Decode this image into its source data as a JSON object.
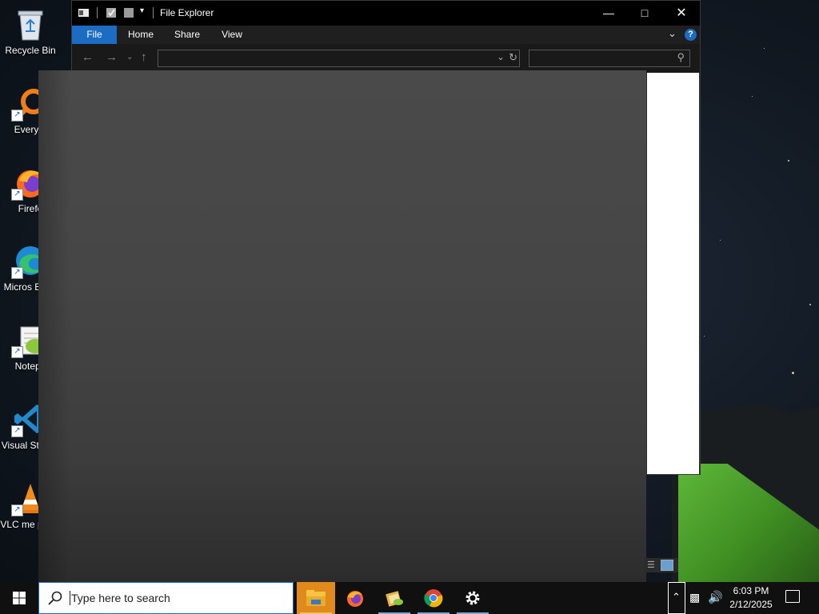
{
  "desktop": {
    "icons": [
      {
        "label": "Recycle Bin",
        "shortcut": false
      },
      {
        "label": "Everyth",
        "shortcut": true
      },
      {
        "label": "Firefo",
        "shortcut": true
      },
      {
        "label": "Micros Edge",
        "shortcut": true
      },
      {
        "label": "Notepa",
        "shortcut": true
      },
      {
        "label": "Visual St Cod",
        "shortcut": true
      },
      {
        "label": "VLC me playe",
        "shortcut": true
      }
    ]
  },
  "explorer": {
    "title": "File Explorer",
    "tabs": [
      "File",
      "Home",
      "Share",
      "View"
    ],
    "address_value": "",
    "search_placeholder": "",
    "colors": {
      "accent": "#1c6cc4",
      "titlebar": "#000000"
    }
  },
  "taskbar": {
    "search_placeholder": "Type here to search",
    "apps": [
      {
        "name": "File Explorer",
        "active": true
      },
      {
        "name": "Firefox",
        "active": false
      },
      {
        "name": "Notepad++",
        "active": false
      },
      {
        "name": "Google Chrome",
        "active": false
      },
      {
        "name": "Settings",
        "active": false
      }
    ],
    "clock": {
      "time": "6:03 PM",
      "date": "2/12/2025"
    }
  }
}
